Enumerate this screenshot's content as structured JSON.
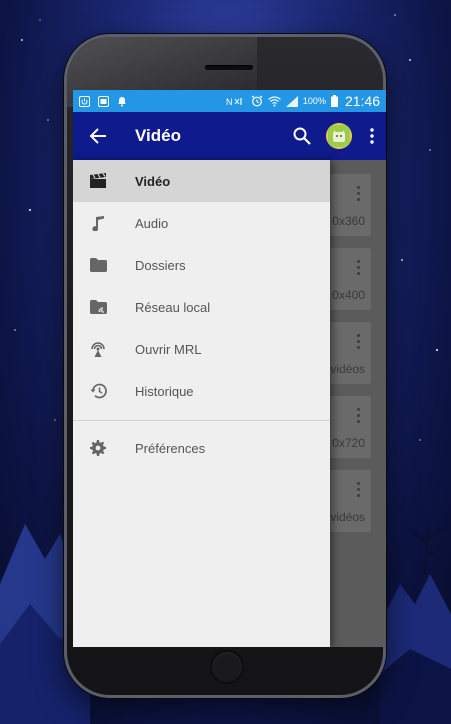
{
  "status_bar": {
    "battery_percent": "100%",
    "time": "21:46"
  },
  "toolbar": {
    "title": "Vidéo"
  },
  "drawer": {
    "items": [
      {
        "label": "Vidéo",
        "icon": "clapperboard-icon",
        "active": true
      },
      {
        "label": "Audio",
        "icon": "music-note-icon",
        "active": false
      },
      {
        "label": "Dossiers",
        "icon": "folder-icon",
        "active": false
      },
      {
        "label": "Réseau local",
        "icon": "network-folder-icon",
        "active": false
      },
      {
        "label": "Ouvrir MRL",
        "icon": "antenna-icon",
        "active": false
      },
      {
        "label": "Historique",
        "icon": "history-icon",
        "active": false
      }
    ],
    "settings": {
      "label": "Préférences",
      "icon": "gear-icon"
    }
  },
  "background_list": {
    "captions": [
      "0x360",
      "0x400",
      "vidéos",
      "0x720",
      "vidéos"
    ]
  },
  "colors": {
    "status_bar": "#2397e6",
    "toolbar": "#0f1a8c",
    "drawer_bg": "#efefef",
    "active_item": "#d5d5d5"
  }
}
